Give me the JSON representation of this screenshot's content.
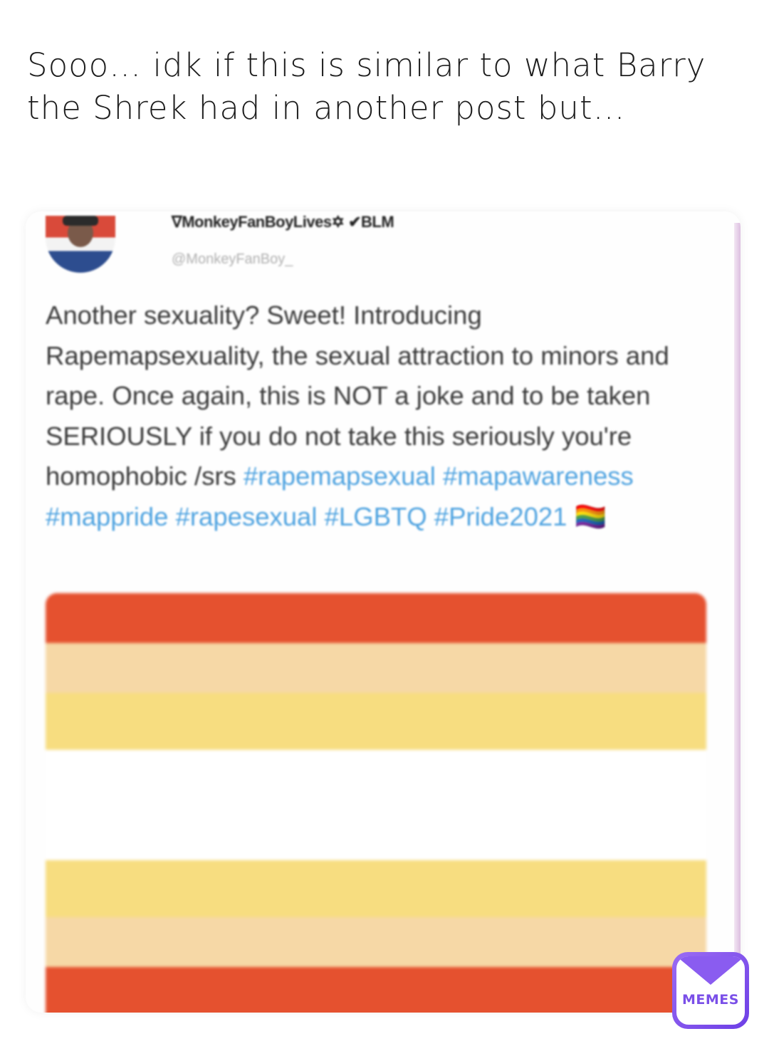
{
  "caption": "Sooo… idk if this is similar to what Barry the Shrek had in another post but…",
  "tweet": {
    "display_name": "∇MonkeyFanBoyLives✡ ✔BLM",
    "handle": "@MonkeyFanBoy_",
    "text": "Another sexuality? Sweet! Introducing Rapemapsexuality, the sexual attraction to minors and rape. Once again, this is NOT a joke and to be taken SERIOUSLY if you do not take this seriously you're homophobic /srs",
    "hashtags": "#rapemapsexual #mapawareness #mappride #rapesexual #LGBTQ #Pride2021",
    "emoji": "🏳️‍🌈",
    "flag_colors": [
      "#e5512f",
      "#f6d8a6",
      "#f7dd80",
      "#ffffff",
      "#f7dd80",
      "#f6d8a6",
      "#e5512f"
    ]
  },
  "watermark": {
    "label": "MEMES",
    "accent": "#7a4fe8"
  }
}
